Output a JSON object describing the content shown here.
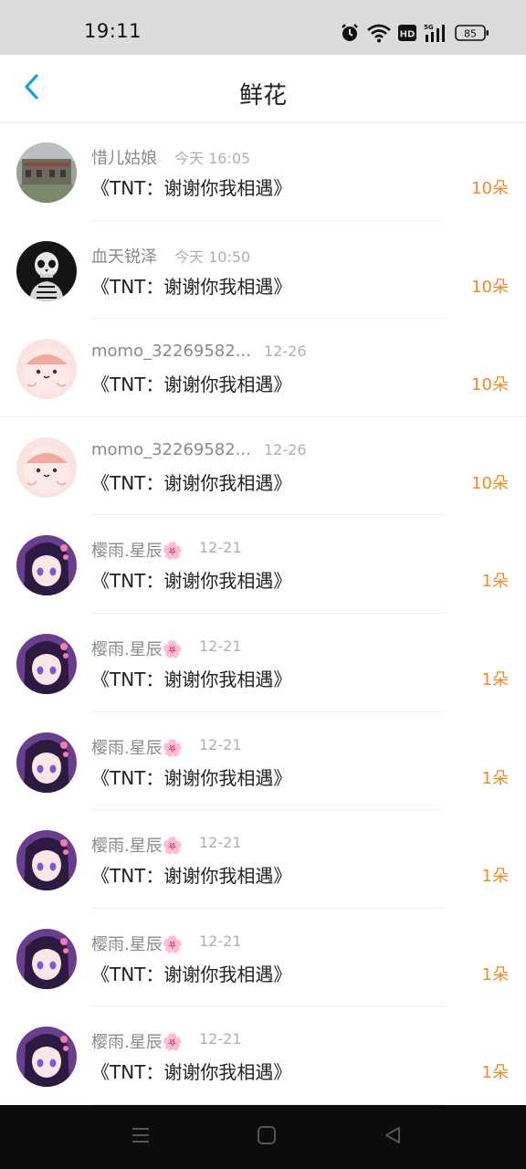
{
  "status": {
    "time": "19:11",
    "battery": "85",
    "icons": [
      "alarm-icon",
      "wifi-icon",
      "hd-icon",
      "signal-5g-icon",
      "battery-icon"
    ]
  },
  "header": {
    "title": "鲜花",
    "back_icon": "chevron-left-icon"
  },
  "items": [
    {
      "name": "惜儿姑娘",
      "time": "今天 16:05",
      "song": "《TNT：谢谢你我相遇》",
      "count": "10朵",
      "avatar": "photo-building"
    },
    {
      "name": "血天锐泽",
      "time": "今天 10:50",
      "song": "《TNT：谢谢你我相遇》",
      "count": "10朵",
      "avatar": "skull"
    },
    {
      "name": "momo_32269582...",
      "time": "12-26",
      "song": "《TNT：谢谢你我相遇》",
      "count": "10朵",
      "avatar": "pink-blob"
    },
    {
      "name": "momo_32269582...",
      "time": "12-26",
      "song": "《TNT：谢谢你我相遇》",
      "count": "10朵",
      "avatar": "pink-blob"
    },
    {
      "name": "樱雨.星辰🌸",
      "time": "12-21",
      "song": "《TNT：谢谢你我相遇》",
      "count": "1朵",
      "avatar": "anime-girl"
    },
    {
      "name": "樱雨.星辰🌸",
      "time": "12-21",
      "song": "《TNT：谢谢你我相遇》",
      "count": "1朵",
      "avatar": "anime-girl"
    },
    {
      "name": "樱雨.星辰🌸",
      "time": "12-21",
      "song": "《TNT：谢谢你我相遇》",
      "count": "1朵",
      "avatar": "anime-girl"
    },
    {
      "name": "樱雨.星辰🌸",
      "time": "12-21",
      "song": "《TNT：谢谢你我相遇》",
      "count": "1朵",
      "avatar": "anime-girl"
    },
    {
      "name": "樱雨.星辰🌸",
      "time": "12-21",
      "song": "《TNT：谢谢你我相遇》",
      "count": "1朵",
      "avatar": "anime-girl"
    },
    {
      "name": "樱雨.星辰🌸",
      "time": "12-21",
      "song": "《TNT：谢谢你我相遇》",
      "count": "1朵",
      "avatar": "anime-girl"
    }
  ],
  "nav": {
    "buttons": [
      "menu-icon",
      "home-square-icon",
      "back-triangle-icon"
    ]
  },
  "colors": {
    "accent_back": "#1a9ee8",
    "count_orange": "#f08a24",
    "status_bar_bg": "#dcdcdc",
    "nav_bar_bg": "#0c0c0c"
  }
}
